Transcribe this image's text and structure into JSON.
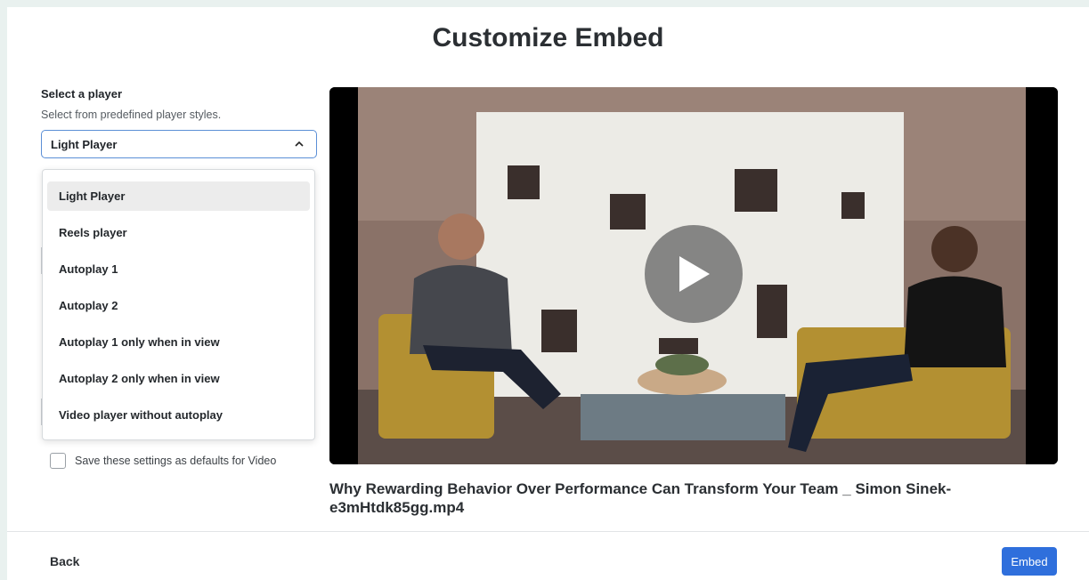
{
  "title": "Customize Embed",
  "player": {
    "label": "Select a player",
    "help": "Select from predefined player styles.",
    "selected": "Light Player",
    "options": [
      "Light Player",
      "Reels player",
      "Autoplay 1",
      "Autoplay 2",
      "Autoplay 1 only when in view",
      "Autoplay 2 only when in view",
      "Video player without autoplay"
    ]
  },
  "save_defaults_label": "Save these settings as defaults for Video",
  "video": {
    "filename": "Why Rewarding Behavior Over Performance Can Transform Your Team _ Simon Sinek-e3mHtdk85gg.mp4"
  },
  "footer": {
    "back_label": "Back",
    "embed_label": "Embed"
  },
  "colors": {
    "accent": "#2f6fdc",
    "focus_border": "#5b8fd6",
    "page_bg": "#e9f1ef"
  }
}
